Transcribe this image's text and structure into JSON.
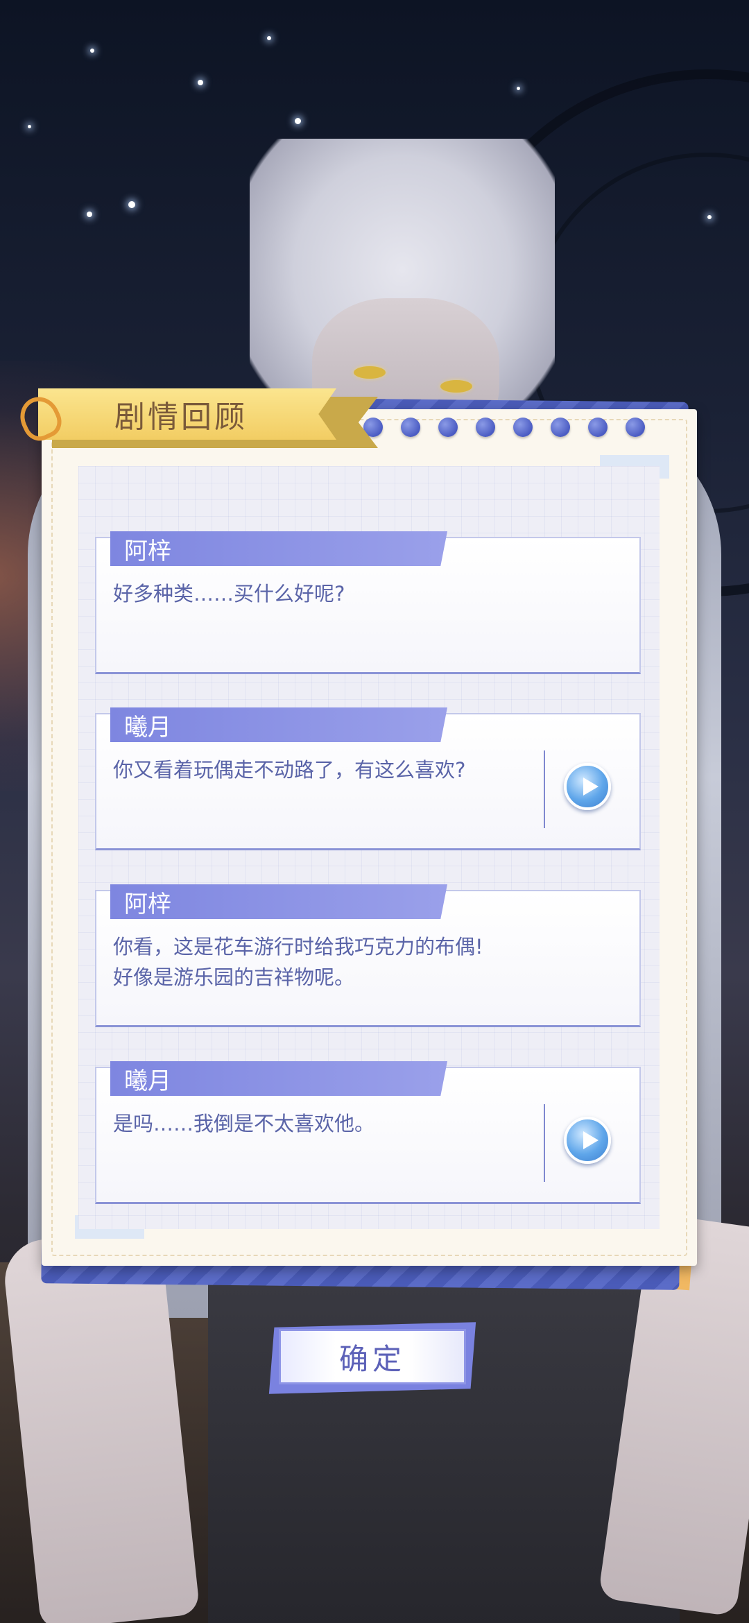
{
  "panel": {
    "title": "剧情回顾"
  },
  "dialogues": [
    {
      "speaker": "阿梓",
      "text": "好多种类……买什么好呢?",
      "has_voice": false
    },
    {
      "speaker": "曦月",
      "text": "你又看着玩偶走不动路了，有这么喜欢?",
      "has_voice": true
    },
    {
      "speaker": "阿梓",
      "text": "你看，这是花车游行时给我巧克力的布偶!\n好像是游乐园的吉祥物呢。",
      "has_voice": false
    },
    {
      "speaker": "曦月",
      "text": "是吗……我倒是不太喜欢他。",
      "has_voice": true
    }
  ],
  "confirm": {
    "label": "确定"
  },
  "colors": {
    "accent": "#7e86e0",
    "ribbon": "#f2cd63",
    "dialogue_text": "#5a64a8",
    "panel_bg": "#fbf7ee"
  },
  "icons": {
    "voice_play": "play-icon",
    "clip": "paperclip-icon"
  }
}
